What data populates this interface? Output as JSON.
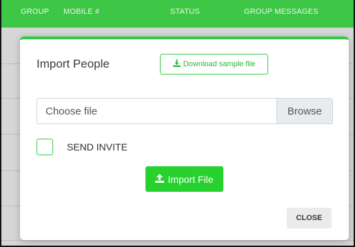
{
  "table": {
    "columns": [
      "GROUP",
      "MOBILE #",
      "STATUS",
      "GROUP MESSAGES"
    ]
  },
  "modal": {
    "title": "Import People",
    "download_label": "Download sample file",
    "file_placeholder": "Choose file",
    "browse_label": "Browse",
    "send_invite_label": "SEND INVITE",
    "send_invite_checked": false,
    "import_label": "Import File",
    "close_label": "CLOSE"
  },
  "icons": {
    "download": "download-icon",
    "upload": "upload-icon"
  },
  "colors": {
    "accent": "#2ecc40",
    "header_green": "#3ec646",
    "button_green": "#27d22f"
  }
}
